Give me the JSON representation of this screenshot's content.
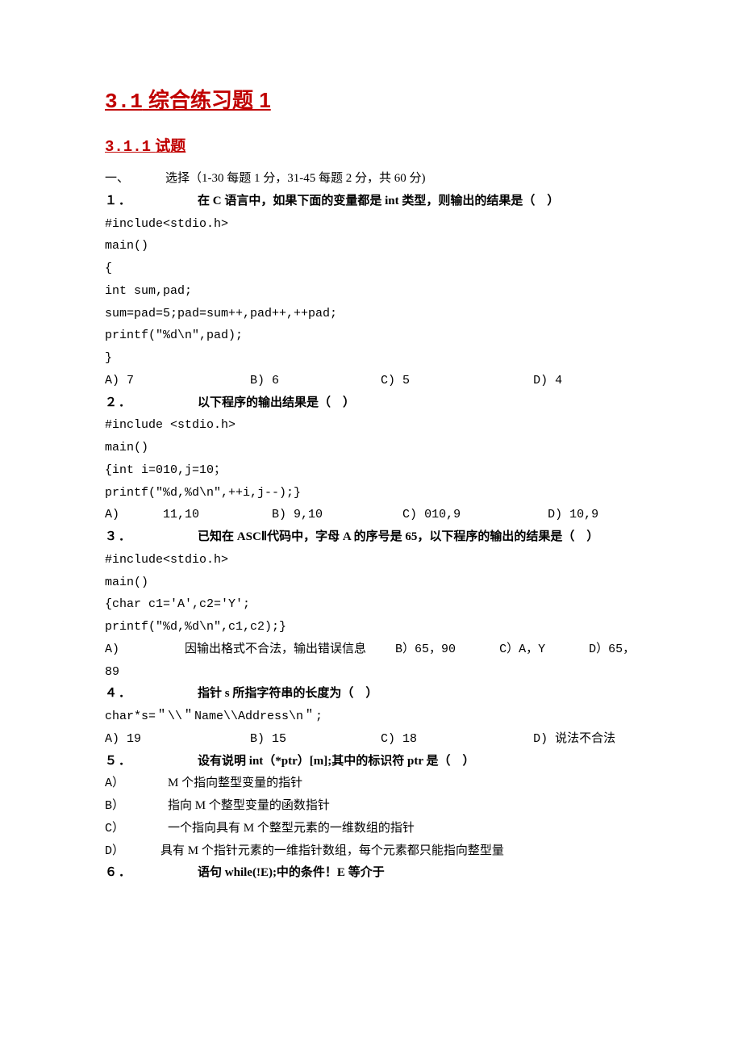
{
  "h1_num": "3.1",
  "h1_gap": "   ",
  "h1_text": "综合练习题 1",
  "h2_num": "3.1.1",
  "h2_gap": "    ",
  "h2_text": "试题",
  "sec1_label": "一、",
  "sec1_gap": "     ",
  "sec1_text": "选择（1-30 每题 1 分，31-45 每题 2 分，共 60 分)",
  "q1": {
    "num": "１．",
    "gap": "         ",
    "stem": "在 C 语言中，如果下面的变量都是 int 类型，则输出的结果是（    ）",
    "c1": "#include<stdio.h>",
    "c2": "main()",
    "c3": "{",
    "c4": "int sum,pad;",
    "c5": "sum=pad=5;pad=sum++,pad++,++pad;",
    "c6": "printf(\"%d\\n\",pad);",
    "c7": "}",
    "opts": "A) 7                B) 6              C) 5                 D) 4"
  },
  "q2": {
    "num": "２．",
    "gap": "         ",
    "stem": "以下程序的输出结果是（    ）",
    "c1": "#include <stdio.h>",
    "c2": "main()",
    "c3": "{int i=010,j=10；",
    "c4": "printf(\"%d,%d\\n\",++i,j--);}",
    "opts": "A)      11,10          B) 9,10           C) 010,9            D) 10,9"
  },
  "q3": {
    "num": "３．",
    "gap": "         ",
    "stem": "已知在 ASCⅡ代码中，字母 A 的序号是 65，以下程序的输出的结果是（    ）",
    "c1": "#include<stdio.h>",
    "c2": "main()",
    "c3": "{char c1='A',c2='Y';",
    "c4": "printf(\"%d,%d\\n\",c1,c2);}",
    "optA_pre": "A)         ",
    "optA_txt": "因输出格式不合法，输出错误信息",
    "optA_rest": "    B）65，90      C）A，Y      D）65，",
    "opt_cont": "89"
  },
  "q4": {
    "num": "４．",
    "gap": "         ",
    "stem": "指针 s 所指字符串的长度为（    ）",
    "c1": "char*s=＂\\\\＂Name\\\\Address\\n＂;",
    "optsA": "A) 19               B) 15             C) 18                D) ",
    "optsD": "说法不合法"
  },
  "q5": {
    "num": "５．",
    "gap": "         ",
    "stem": "设有说明 int（*ptr）[m];其中的标识符 ptr 是（    ）",
    "a_pre": "A）      ",
    "a": "M 个指向整型变量的指针",
    "b_pre": "B）      ",
    "b": "指向 M 个整型变量的函数指针",
    "c_pre": "C）      ",
    "c": "一个指向具有 M 个整型元素的一维数组的指针",
    "d_pre": "D）     ",
    "d": "具有 M 个指针元素的一维指针数组，每个元素都只能指向整型量"
  },
  "q6": {
    "num": "６．",
    "gap": "         ",
    "stem": "语句 while(!E);中的条件！E 等介于"
  }
}
